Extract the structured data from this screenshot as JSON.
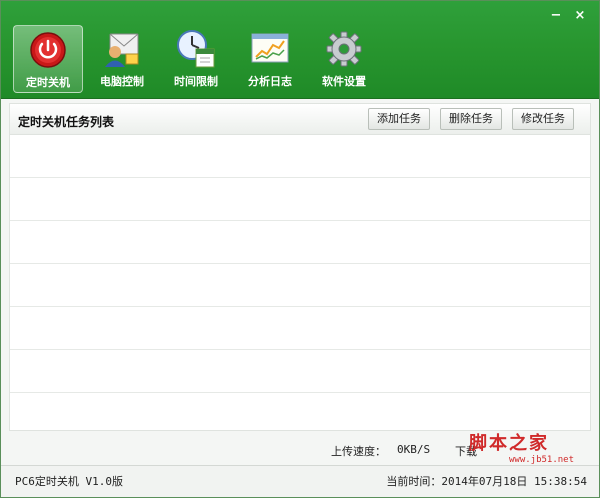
{
  "window": {
    "minimize_glyph": "−",
    "close_glyph": "×"
  },
  "toolbar": {
    "items": [
      {
        "label": "定时关机",
        "icon": "power-icon"
      },
      {
        "label": "电脑控制",
        "icon": "mail-user-icon"
      },
      {
        "label": "时间限制",
        "icon": "clock-calendar-icon"
      },
      {
        "label": "分析日志",
        "icon": "chart-window-icon"
      },
      {
        "label": "软件设置",
        "icon": "gear-icon"
      }
    ]
  },
  "panel": {
    "title": "定时关机任务列表",
    "add_label": "添加任务",
    "delete_label": "删除任务",
    "edit_label": "修改任务"
  },
  "speed": {
    "upload_label": "上传速度：",
    "upload_value": "0KB/S",
    "download_label": "下载"
  },
  "watermark": {
    "text": "脚本之家",
    "url": "www.jb51.net"
  },
  "status": {
    "version": "PC6定时关机 V1.0版",
    "time": "当前时间：2014年07月18日 15:38:54"
  },
  "colors": {
    "header_green": "#28962f",
    "watermark_red": "#d02a2a"
  }
}
